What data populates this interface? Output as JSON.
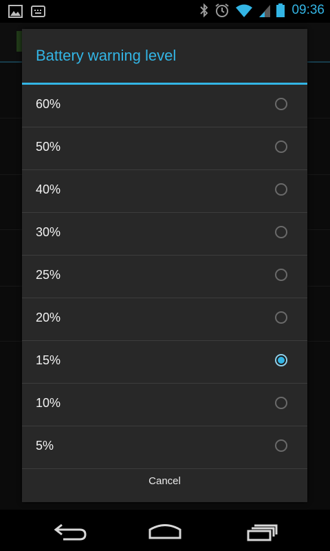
{
  "status_bar": {
    "time": "09:36",
    "left_icons": [
      "image-notification-icon",
      "keyboard-notification-icon"
    ],
    "right_icons": [
      "bluetooth-icon",
      "alarm-icon",
      "wifi-icon",
      "signal-icon",
      "battery-icon"
    ],
    "accent_color": "#33b5e5"
  },
  "dialog": {
    "title": "Battery warning level",
    "options": [
      {
        "label": "60%",
        "selected": false
      },
      {
        "label": "50%",
        "selected": false
      },
      {
        "label": "40%",
        "selected": false
      },
      {
        "label": "30%",
        "selected": false
      },
      {
        "label": "25%",
        "selected": false
      },
      {
        "label": "20%",
        "selected": false
      },
      {
        "label": "15%",
        "selected": true
      },
      {
        "label": "10%",
        "selected": false
      },
      {
        "label": "5%",
        "selected": false
      }
    ],
    "cancel_label": "Cancel"
  },
  "nav_bar": {
    "buttons": [
      "back-icon",
      "home-icon",
      "recent-apps-icon"
    ]
  }
}
